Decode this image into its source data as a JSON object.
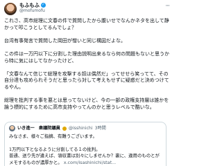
{
  "author": {
    "display_name": "もふもふ",
    "handle": "@mofumofu"
  },
  "more_label": "···",
  "body": {
    "p1": "これさ、高市総理に文春の件で質問したから腹いせでなんかネタを出して静かって叩こうとしてるんでしょ？",
    "p2": "台湾有事発言で質問した岡田が憎いと同じ構図だよな。",
    "p3": "この件は一万円以下に分割した理由説明出来るなら何の問題もないと思うから特に気にはしてなかったけど、",
    "p4": "「文春なんて信じて総理を攻撃する奴は偶然だ」ってせせら笑ってて、その自分達も攻められそうだと思ったら対して考えもせずに疑惑だと決めつけてるやん。",
    "p5": "総理を批判する事を悪とは思ってないけど、今の一部の政権支持層は誰かを論う標的にするために高市支持やってんのかと思うレベルで酷いな。"
  },
  "quote": {
    "name": "いき進一　衆議院議員",
    "handle": "@isshinichi",
    "time": "3時間",
    "line1": "みなさま、様々ご指摘、有難うございます。",
    "line2": "1万円以下となるように分割してる１の批判。",
    "line3": "普通、送り先が違えば、領収書は別々にしませんか？裏に、違用のものとがメモするものが濃厚かと。",
    "link": "x.com/isashinichi/stat..."
  }
}
